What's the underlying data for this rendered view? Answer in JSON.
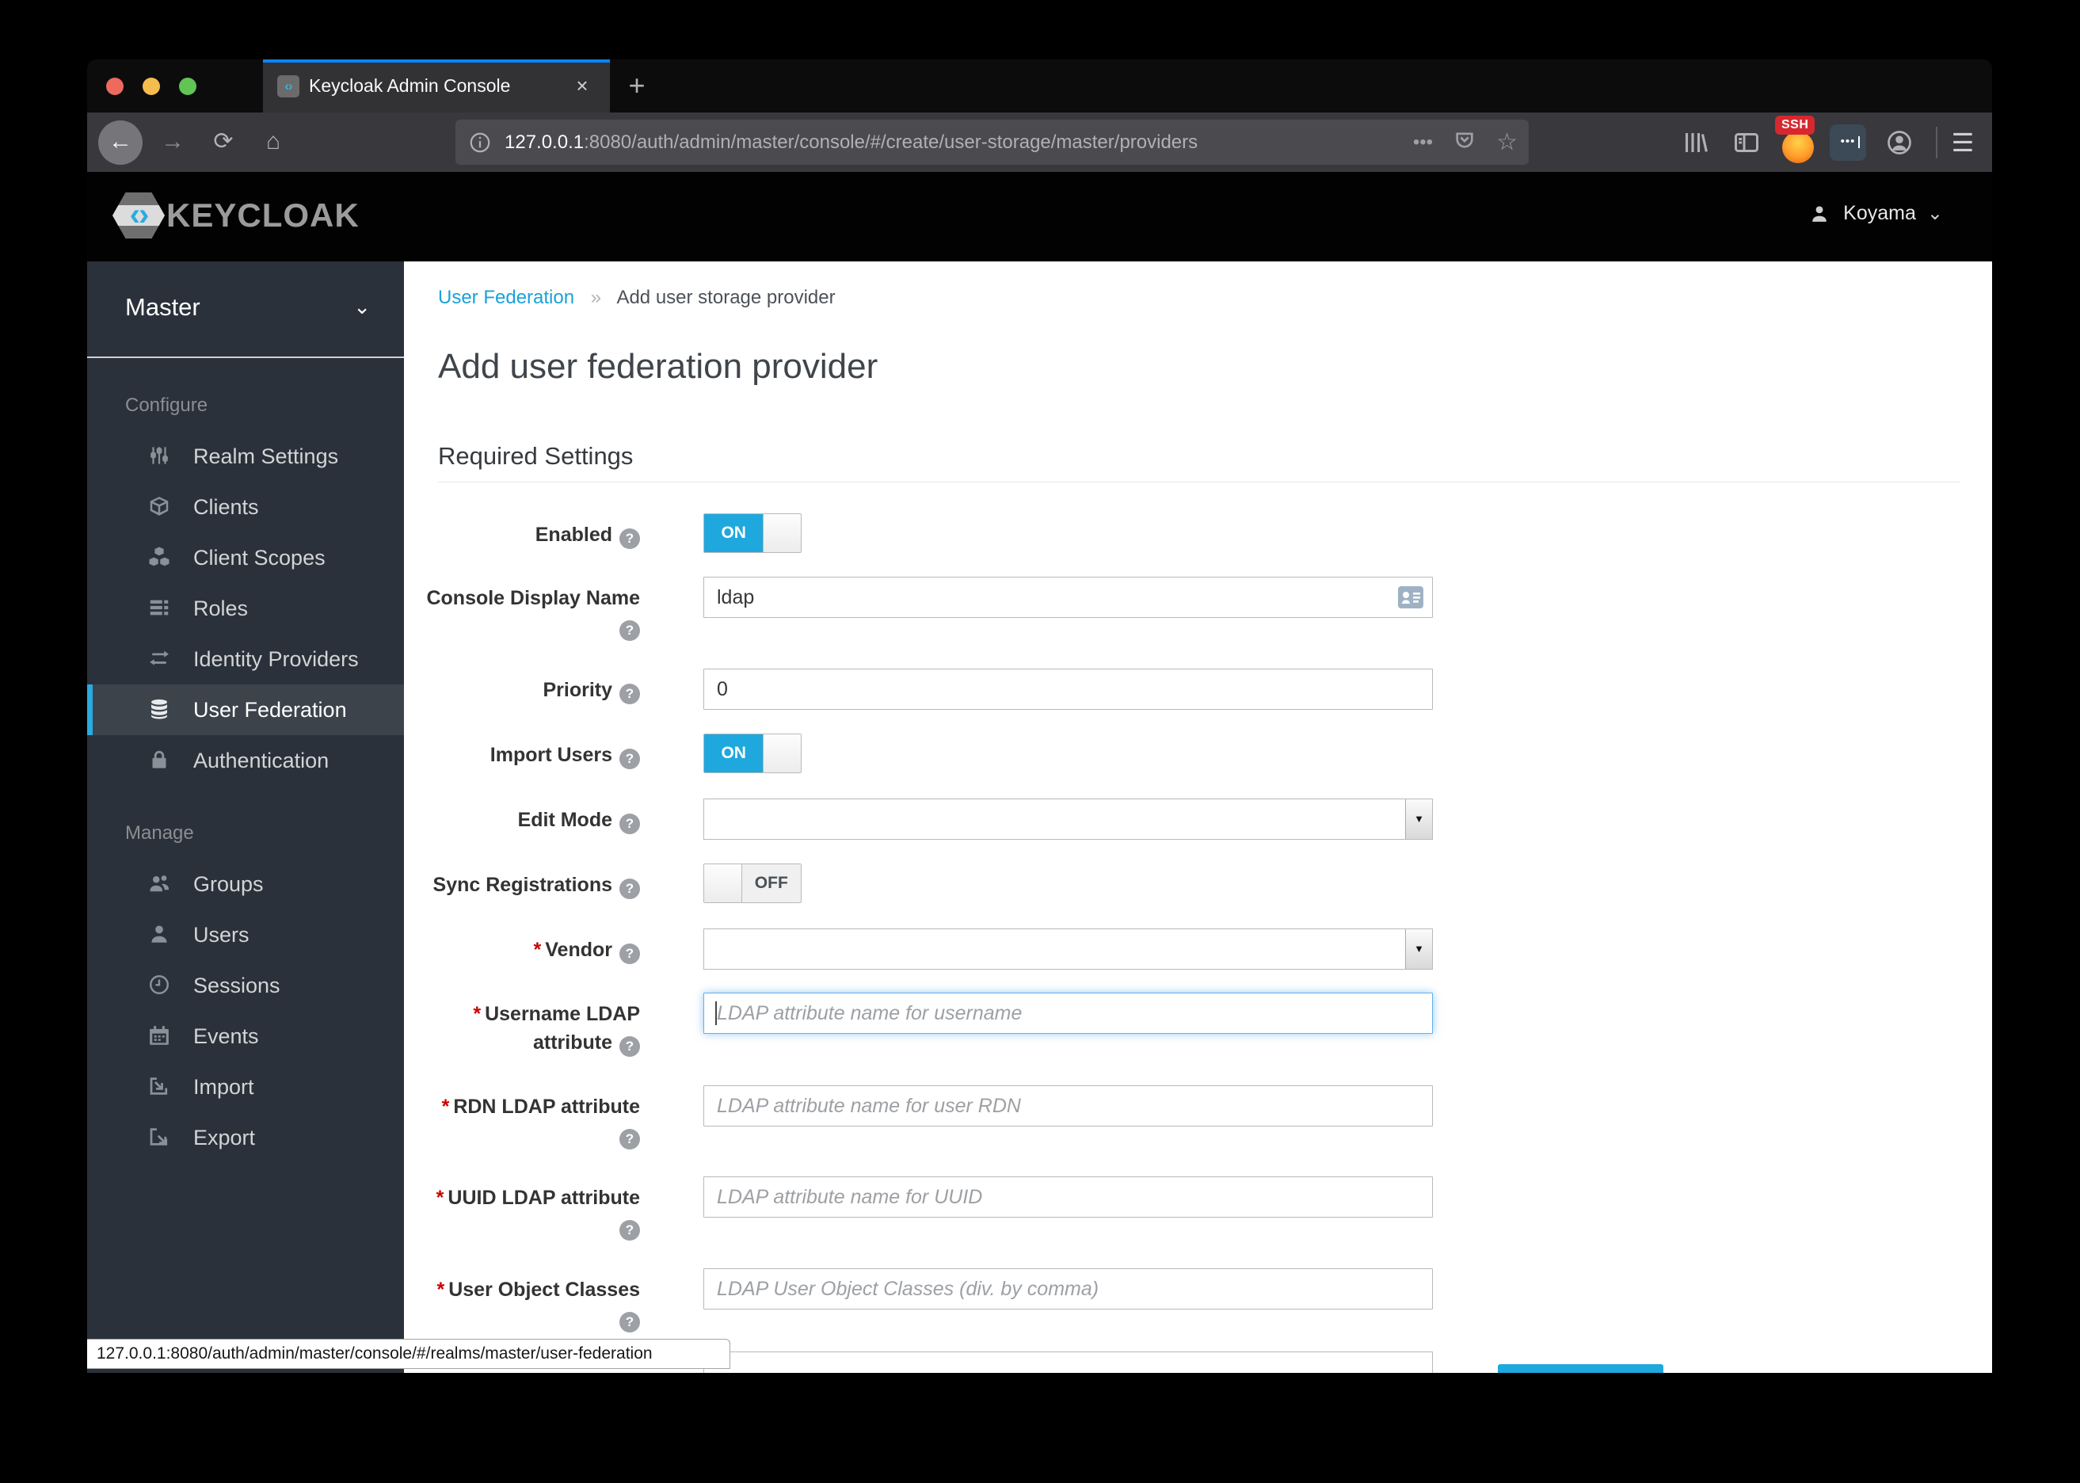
{
  "browser": {
    "tab": {
      "title": "Keycloak Admin Console"
    },
    "urlbar": {
      "host": "127.0.0.1",
      "rest": ":8080/auth/admin/master/console/#/create/user-storage/master/providers"
    },
    "extensions": {
      "ssh_badge": "SSH",
      "password_dots": "•••"
    }
  },
  "icons": {
    "back": "←",
    "forward": "→",
    "refresh": "⟳",
    "home": "⌂",
    "ellipsis": "•••",
    "star": "☆",
    "close_tab": "×",
    "new_tab": "+",
    "hamburger": "☰",
    "chevron_down": "⌄",
    "select_arrow": "▼",
    "keycloak_mark": "‹›"
  },
  "header": {
    "brand": "KEYCLOAK",
    "user": "Koyama"
  },
  "sidebar": {
    "realm": {
      "name": "Master"
    },
    "sections": [
      {
        "label": "Configure",
        "items": [
          {
            "label": "Realm Settings"
          },
          {
            "label": "Clients"
          },
          {
            "label": "Client Scopes"
          },
          {
            "label": "Roles"
          },
          {
            "label": "Identity Providers"
          },
          {
            "label": "User Federation",
            "active": true
          },
          {
            "label": "Authentication"
          }
        ]
      },
      {
        "label": "Manage",
        "items": [
          {
            "label": "Groups"
          },
          {
            "label": "Users"
          },
          {
            "label": "Sessions"
          },
          {
            "label": "Events"
          },
          {
            "label": "Import"
          },
          {
            "label": "Export"
          }
        ]
      }
    ]
  },
  "main": {
    "breadcrumb": {
      "parent": "User Federation",
      "separator": "»",
      "current": "Add user storage provider"
    },
    "title": "Add user federation provider",
    "section_title": "Required Settings"
  },
  "form": {
    "required_marker": "*",
    "help_glyph": "?",
    "rows": [
      {
        "label": "Enabled",
        "control": "toggle",
        "state": "ON"
      },
      {
        "label": "Console Display Name",
        "control": "text",
        "value": "ldap"
      },
      {
        "label": "Priority",
        "control": "text",
        "value": "0"
      },
      {
        "label": "Import Users",
        "control": "toggle",
        "state": "ON"
      },
      {
        "label": "Edit Mode",
        "control": "select",
        "value": ""
      },
      {
        "label": "Sync Registrations",
        "control": "toggle",
        "state": "OFF"
      },
      {
        "label": "Vendor",
        "required": true,
        "control": "select",
        "value": ""
      },
      {
        "label": "Username LDAP attribute",
        "required": true,
        "control": "text",
        "value": "",
        "placeholder": "LDAP attribute name for username",
        "focused": true
      },
      {
        "label": "RDN LDAP attribute",
        "required": true,
        "control": "text",
        "value": "",
        "placeholder": "LDAP attribute name for user RDN"
      },
      {
        "label": "UUID LDAP attribute",
        "required": true,
        "control": "text",
        "value": "",
        "placeholder": "LDAP attribute name for UUID"
      },
      {
        "label": "User Object Classes",
        "required": true,
        "control": "text",
        "value": "",
        "placeholder": "LDAP User Object Classes (div. by comma)"
      }
    ]
  },
  "statusbar": {
    "text": "127.0.0.1:8080/auth/admin/master/console/#/realms/master/user-federation"
  },
  "colors": {
    "accent": "#1fa8dd",
    "tab_stripe": "#0a84ff",
    "active_item_bar": "#2aabe2",
    "required": "#cc0000"
  }
}
